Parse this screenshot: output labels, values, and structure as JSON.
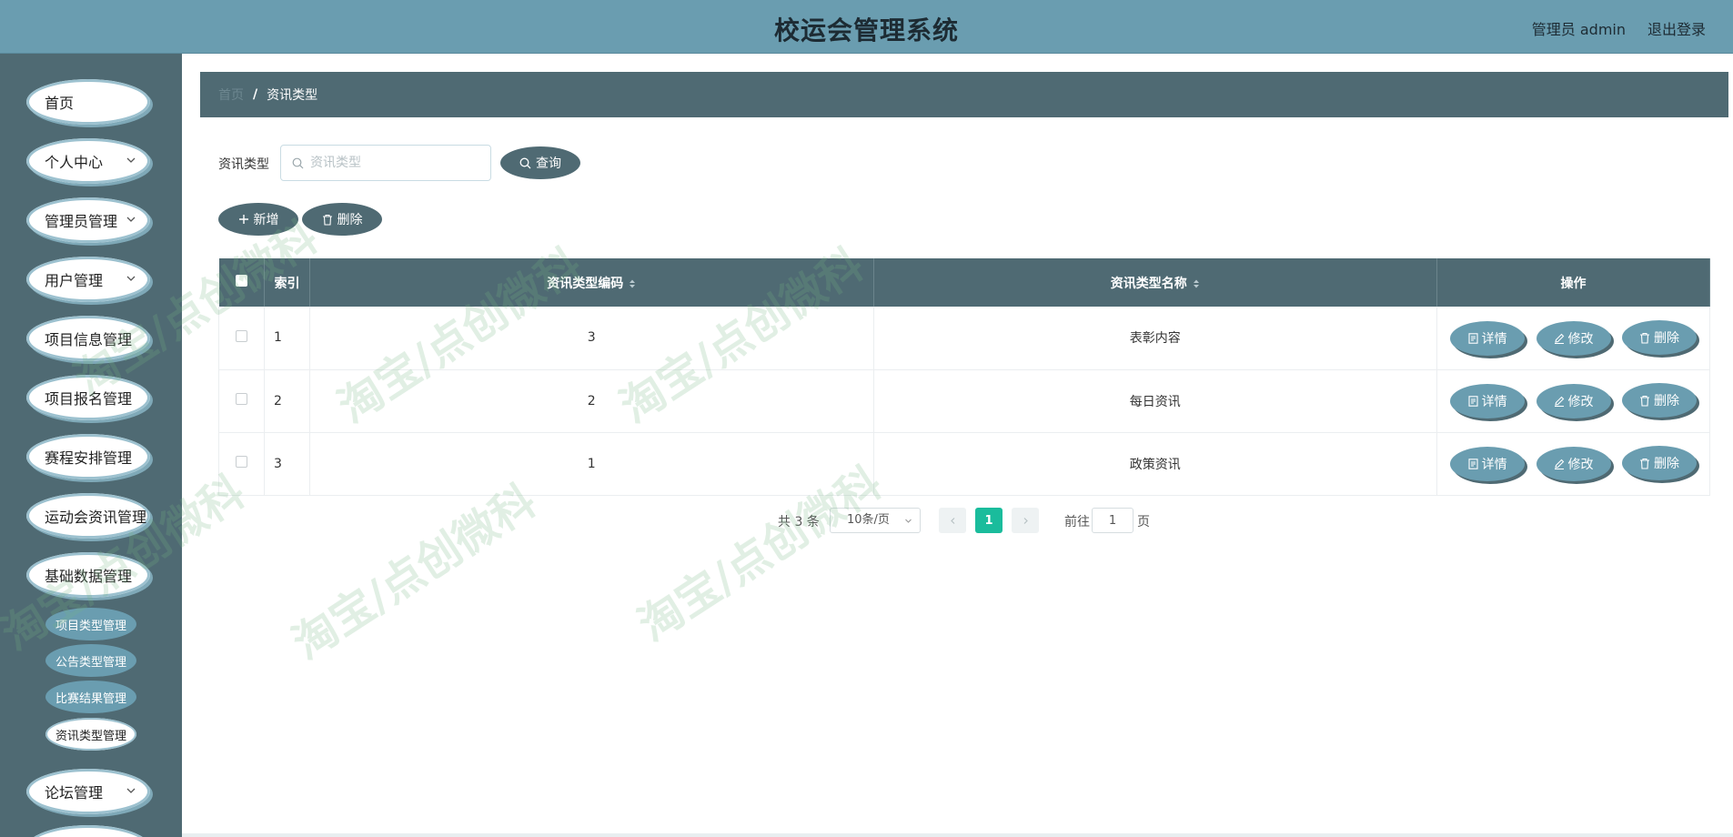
{
  "header": {
    "title": "校运会管理系统",
    "user": "管理员 admin",
    "logout": "退出登录"
  },
  "sidebar": {
    "items": [
      {
        "label": "首页",
        "has_children": false
      },
      {
        "label": "个人中心",
        "has_children": true
      },
      {
        "label": "管理员管理",
        "has_children": true
      },
      {
        "label": "用户管理",
        "has_children": true
      },
      {
        "label": "项目信息管理",
        "has_children": false
      },
      {
        "label": "项目报名管理",
        "has_children": false
      },
      {
        "label": "赛程安排管理",
        "has_children": false
      },
      {
        "label": "运动会资讯管理",
        "has_children": false
      },
      {
        "label": "基础数据管理",
        "has_children": false
      },
      {
        "label": "论坛管理",
        "has_children": true
      }
    ],
    "sub_items": [
      {
        "label": "项目类型管理",
        "active": false
      },
      {
        "label": "公告类型管理",
        "active": false
      },
      {
        "label": "比赛结果管理",
        "active": false
      },
      {
        "label": "资讯类型管理",
        "active": true
      }
    ]
  },
  "breadcrumb": {
    "home": "首页",
    "separator": "/",
    "current": "资讯类型"
  },
  "search": {
    "label": "资讯类型",
    "placeholder": "资讯类型",
    "value": "",
    "button": "查询"
  },
  "actions": {
    "add": "新增",
    "delete": "删除"
  },
  "table": {
    "columns": [
      "索引",
      "资讯类型编码",
      "资讯类型名称",
      "操作"
    ],
    "rows": [
      {
        "index": "1",
        "code": "3",
        "name": "表彰内容"
      },
      {
        "index": "2",
        "code": "2",
        "name": "每日资讯"
      },
      {
        "index": "3",
        "code": "1",
        "name": "政策资讯"
      }
    ],
    "row_actions": {
      "detail": "详情",
      "edit": "修改",
      "delete": "删除"
    }
  },
  "pagination": {
    "total": "共 3 条",
    "page_size": "10条/页",
    "current_page": "1",
    "goto_prefix": "前往",
    "goto_value": "1",
    "goto_suffix": "页"
  },
  "watermark": "淘宝/点创微科",
  "colors": {
    "header": "#6a9db0",
    "sidebar": "#4f6a73",
    "accent": "#1abc9c"
  }
}
